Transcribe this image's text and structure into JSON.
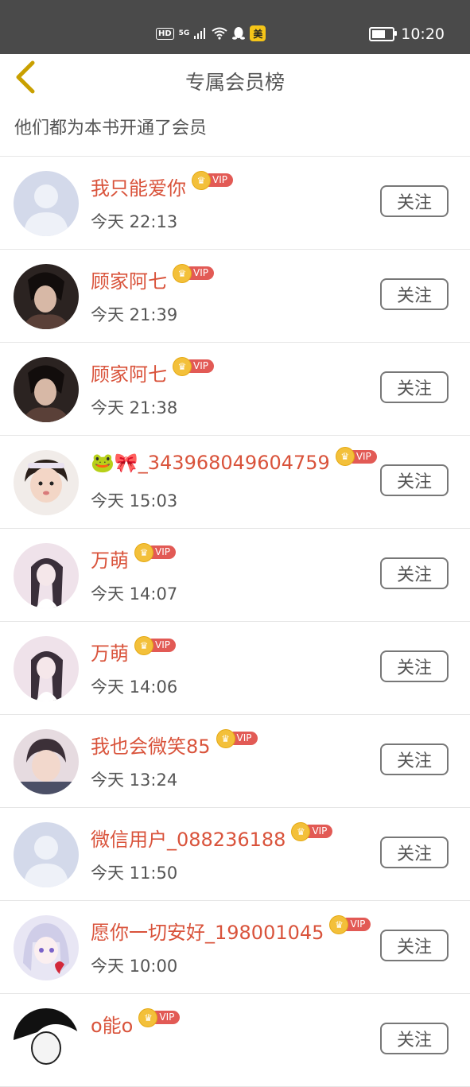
{
  "status_bar": {
    "hd": "HD",
    "net": "5G",
    "app_badge": "美",
    "time": "10:20"
  },
  "header": {
    "back_icon": "chevron-left-icon",
    "title": "专属会员榜",
    "subtitle": "他们都为本书开通了会员"
  },
  "vip_label": "VIP",
  "follow_label": "关注",
  "colors": {
    "status_bg": "#4a4a4a",
    "name": "#d9533b",
    "vip_tag": "#e25a55",
    "crown": "#f3c03a",
    "back_arrow": "#c9a000"
  },
  "members": [
    {
      "name": "我只能爱你",
      "time": "今天 22:13",
      "avatar": "default"
    },
    {
      "name": "顾家阿七",
      "time": "今天 21:39",
      "avatar": "dark-man"
    },
    {
      "name": "顾家阿七",
      "time": "今天 21:38",
      "avatar": "dark-man"
    },
    {
      "name": "🐸🎀_343968049604759",
      "time": "今天 15:03",
      "avatar": "child"
    },
    {
      "name": "万萌",
      "time": "今天 14:07",
      "avatar": "anime-girl"
    },
    {
      "name": "万萌",
      "time": "今天 14:06",
      "avatar": "anime-girl"
    },
    {
      "name": "我也会微笑85",
      "time": "今天 13:24",
      "avatar": "kid-photo"
    },
    {
      "name": "微信用户_088236188",
      "time": "今天 11:50",
      "avatar": "default"
    },
    {
      "name": "愿你一切安好_198001045",
      "time": "今天 10:00",
      "avatar": "anime-white"
    },
    {
      "name": "o能o",
      "time": "",
      "avatar": "manga"
    }
  ]
}
